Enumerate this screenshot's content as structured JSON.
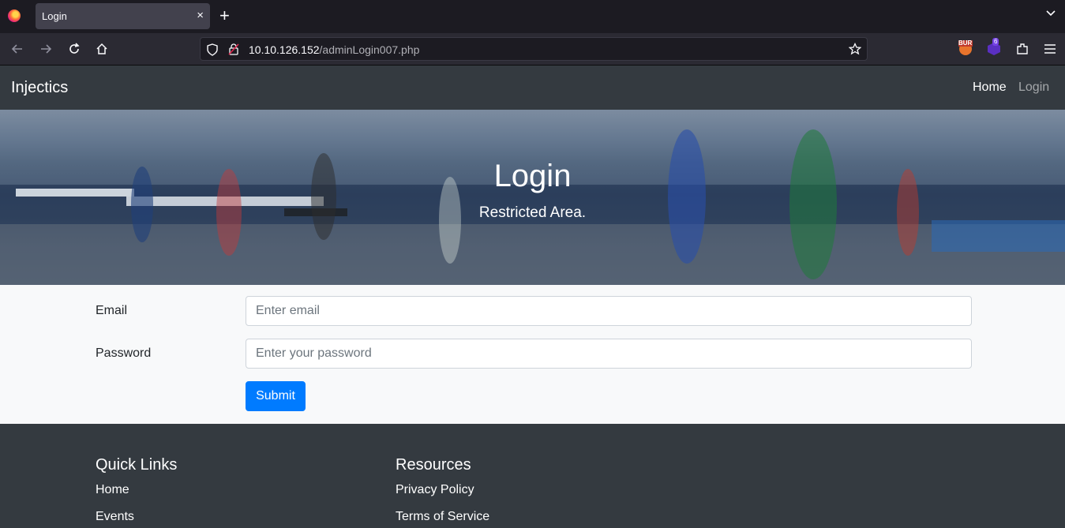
{
  "browser": {
    "tab_title": "Login",
    "tab_close": "×",
    "new_tab": "+",
    "url_host": "10.10.126.152",
    "url_path": "/adminLogin007.php",
    "extension_badge": "6",
    "extension_burp_label": "BUR"
  },
  "site_nav": {
    "brand": "Injectics",
    "links": [
      {
        "label": "Home"
      },
      {
        "label": "Login"
      }
    ]
  },
  "hero": {
    "title": "Login",
    "subtitle": "Restricted Area."
  },
  "form": {
    "email_label": "Email",
    "email_placeholder": "Enter email",
    "email_value": "",
    "password_label": "Password",
    "password_placeholder": "Enter your password",
    "password_value": "",
    "submit_label": "Submit"
  },
  "footer": {
    "quick_links": {
      "heading": "Quick Links",
      "items": [
        {
          "label": "Home"
        },
        {
          "label": "Events"
        }
      ]
    },
    "resources": {
      "heading": "Resources",
      "items": [
        {
          "label": "Privacy Policy"
        },
        {
          "label": "Terms of Service"
        }
      ]
    }
  },
  "colors": {
    "primary": "#007bff",
    "dark": "#343a40",
    "light": "#f8f9fa"
  }
}
